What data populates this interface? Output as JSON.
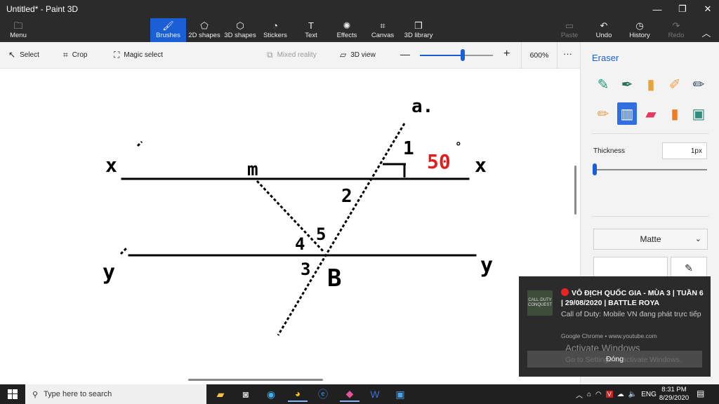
{
  "window": {
    "title": "Untitled* - Paint 3D",
    "controls": {
      "minimize": "—",
      "maximize": "❐",
      "close": "✕"
    }
  },
  "ribbon": {
    "menu": {
      "label": "Menu",
      "icon": "folder-icon"
    },
    "tools": [
      {
        "label": "Brushes",
        "icon": "brush-icon",
        "active": true
      },
      {
        "label": "2D shapes",
        "icon": "shapes-icon"
      },
      {
        "label": "3D shapes",
        "icon": "cube-icon"
      },
      {
        "label": "Stickers",
        "icon": "sticker-icon"
      },
      {
        "label": "Text",
        "icon": "text-icon"
      },
      {
        "label": "Effects",
        "icon": "sun-icon"
      },
      {
        "label": "Canvas",
        "icon": "canvas-icon"
      },
      {
        "label": "3D library",
        "icon": "library-icon"
      }
    ],
    "right": [
      {
        "label": "Paste",
        "icon": "paste-icon",
        "disabled": true
      },
      {
        "label": "Undo",
        "icon": "undo-icon"
      },
      {
        "label": "History",
        "icon": "history-icon"
      },
      {
        "label": "Redo",
        "icon": "redo-icon",
        "disabled": true
      }
    ]
  },
  "toolbar": {
    "select": "Select",
    "crop": "Crop",
    "magic_select": "Magic select",
    "mixed_reality": "Mixed reality",
    "view_3d": "3D view",
    "zoom_percent": "600%",
    "zoom_level": 0.6,
    "more": "···"
  },
  "side_panel": {
    "title": "Eraser",
    "brushes": [
      "marker",
      "calligraphy-pen",
      "oil-brush",
      "watercolor",
      "pixel-pen",
      "pencil",
      "eraser",
      "crayon",
      "spray-can",
      "fill"
    ],
    "selected_brush": "eraser",
    "thickness_label": "Thickness",
    "thickness_value": "1px",
    "finish": "Matte"
  },
  "drawing": {
    "labels": [
      "a.",
      "x'",
      "m",
      "1",
      "50°",
      "x",
      "2",
      "5",
      "4",
      "y'",
      "y",
      "3",
      "B"
    ],
    "red_value": "50",
    "red_degree": "°"
  },
  "notification": {
    "headline": "VÔ ĐỊCH QUỐC GIA - MÙA 3 | TUẦN 6 | 29/08/2020 | BATTLE ROYA",
    "body": "Call of Duty: Mobile VN đang phát trực tiếp",
    "source": "Google Chrome • www.youtube.com",
    "button": "Đóng",
    "thumb_text": "CALL·DUTY CONQUEST",
    "watermark_line1": "Activate Windows",
    "watermark_line2": "Go to Settings to activate Windows."
  },
  "taskbar": {
    "search_placeholder": "Type here to search",
    "apps": [
      "file-explorer-icon",
      "camera-icon",
      "edge-icon",
      "chrome-icon",
      "ie-icon",
      "paint3d-icon",
      "word-icon",
      "photos-icon"
    ],
    "language": "ENG",
    "time": "8:31 PM",
    "date": "8/29/2020"
  }
}
